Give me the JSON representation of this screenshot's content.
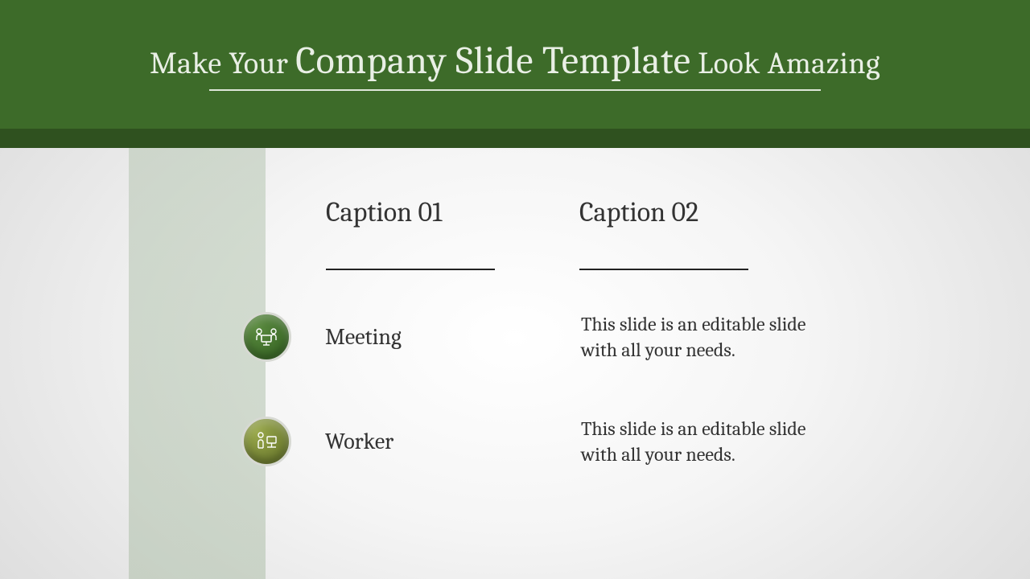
{
  "title": {
    "pre": "Make Your ",
    "main": "Company Slide Template",
    "post": " Look Amazing"
  },
  "columns": {
    "caption1": "Caption 01",
    "caption2": "Caption 02"
  },
  "items": [
    {
      "label": "Meeting",
      "desc": "This slide is an editable slide with all your needs.",
      "icon": "meeting-icon"
    },
    {
      "label": "Worker",
      "desc": "This slide is an editable slide with all your needs.",
      "icon": "worker-icon"
    }
  ],
  "colors": {
    "header": "#3d6b29",
    "header_dark": "#2f511f"
  }
}
